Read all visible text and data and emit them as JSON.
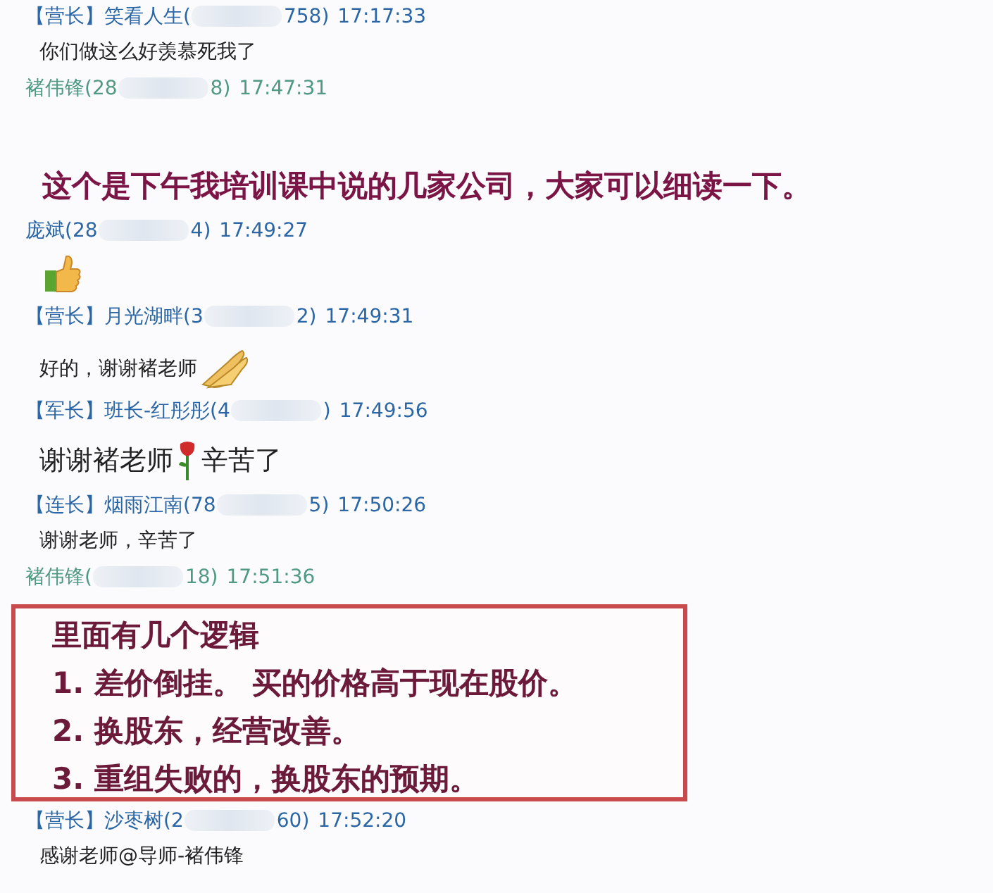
{
  "messages": [
    {
      "kind": "header",
      "self": false,
      "rank": "【营长】",
      "sender": "笑看人生",
      "id_start": "(",
      "id_end": "758)",
      "time": "17:17:33"
    },
    {
      "kind": "plain",
      "parts": [
        {
          "kind": "text",
          "text": "你们做这么好羡慕死我了"
        }
      ]
    },
    {
      "kind": "header",
      "self": true,
      "sender": "褚伟锋",
      "id_start": "(28",
      "id_end": "8)",
      "time": "17:47:31"
    },
    {
      "kind": "headline",
      "parts": [
        {
          "kind": "text",
          "text": "这个是下午我培训课中说的几家公司，大家可以细读一下。"
        }
      ]
    },
    {
      "kind": "header",
      "self": false,
      "sender": "庞斌",
      "id_start": "(28",
      "id_end": "4)",
      "time": "17:49:27"
    },
    {
      "kind": "sticker",
      "parts": [
        {
          "kind": "thumbs_up"
        }
      ]
    },
    {
      "kind": "header",
      "self": false,
      "rank": "【营长】",
      "sender": "月光湖畔",
      "id_start": "(3",
      "id_end": "2)",
      "time": "17:49:31"
    },
    {
      "kind": "plain",
      "parts": [
        {
          "kind": "text",
          "text": "好的，谢谢褚老师"
        },
        {
          "kind": "ok_hand"
        }
      ]
    },
    {
      "kind": "header",
      "self": false,
      "rank": "【军长】",
      "sender": "班长-红彤彤",
      "id_start": "(4",
      "id_end": ")",
      "time": "17:49:56"
    },
    {
      "kind": "large",
      "parts": [
        {
          "kind": "text",
          "text": "谢谢褚老师"
        },
        {
          "kind": "rose"
        },
        {
          "kind": "text",
          "text": "辛苦了"
        }
      ]
    },
    {
      "kind": "header",
      "self": false,
      "rank": "【连长】",
      "sender": "烟雨江南",
      "id_start": "(78",
      "id_end": "5)",
      "time": "17:50:26"
    },
    {
      "kind": "plain",
      "parts": [
        {
          "kind": "text",
          "text": "谢谢老师，辛苦了"
        }
      ]
    },
    {
      "kind": "header",
      "self": true,
      "sender": "褚伟锋",
      "id_start": "(",
      "id_end": "18)",
      "time": "17:51:36"
    },
    {
      "kind": "box",
      "lines": [
        "里面有几个逻辑",
        "1.  差价倒挂。 买的价格高于现在股价。",
        "2.  换股东，经营改善。",
        "3.  重组失败的，换股东的预期。"
      ]
    },
    {
      "kind": "header",
      "self": false,
      "rank": "【营长】",
      "sender": "沙枣树",
      "id_start": "(2",
      "id_end": "60)",
      "time": "17:52:20"
    },
    {
      "kind": "plain",
      "parts": [
        {
          "kind": "text",
          "text": "感谢老师@导师-褚伟锋"
        }
      ]
    }
  ]
}
